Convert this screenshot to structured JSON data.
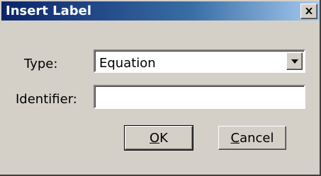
{
  "window": {
    "title": "Insert Label"
  },
  "form": {
    "type_label": "Type:",
    "type_value": "Equation",
    "identifier_label": "Identifier:",
    "identifier_value": ""
  },
  "buttons": {
    "ok": {
      "accel": "O",
      "rest": "K"
    },
    "cancel": {
      "accel": "C",
      "rest": "ancel"
    }
  },
  "colors": {
    "face": "#d4d0c8",
    "title_start": "#0a246a",
    "title_end": "#a6caf0"
  },
  "icons": {
    "close": "close-icon",
    "dropdown": "chevron-down-icon"
  }
}
